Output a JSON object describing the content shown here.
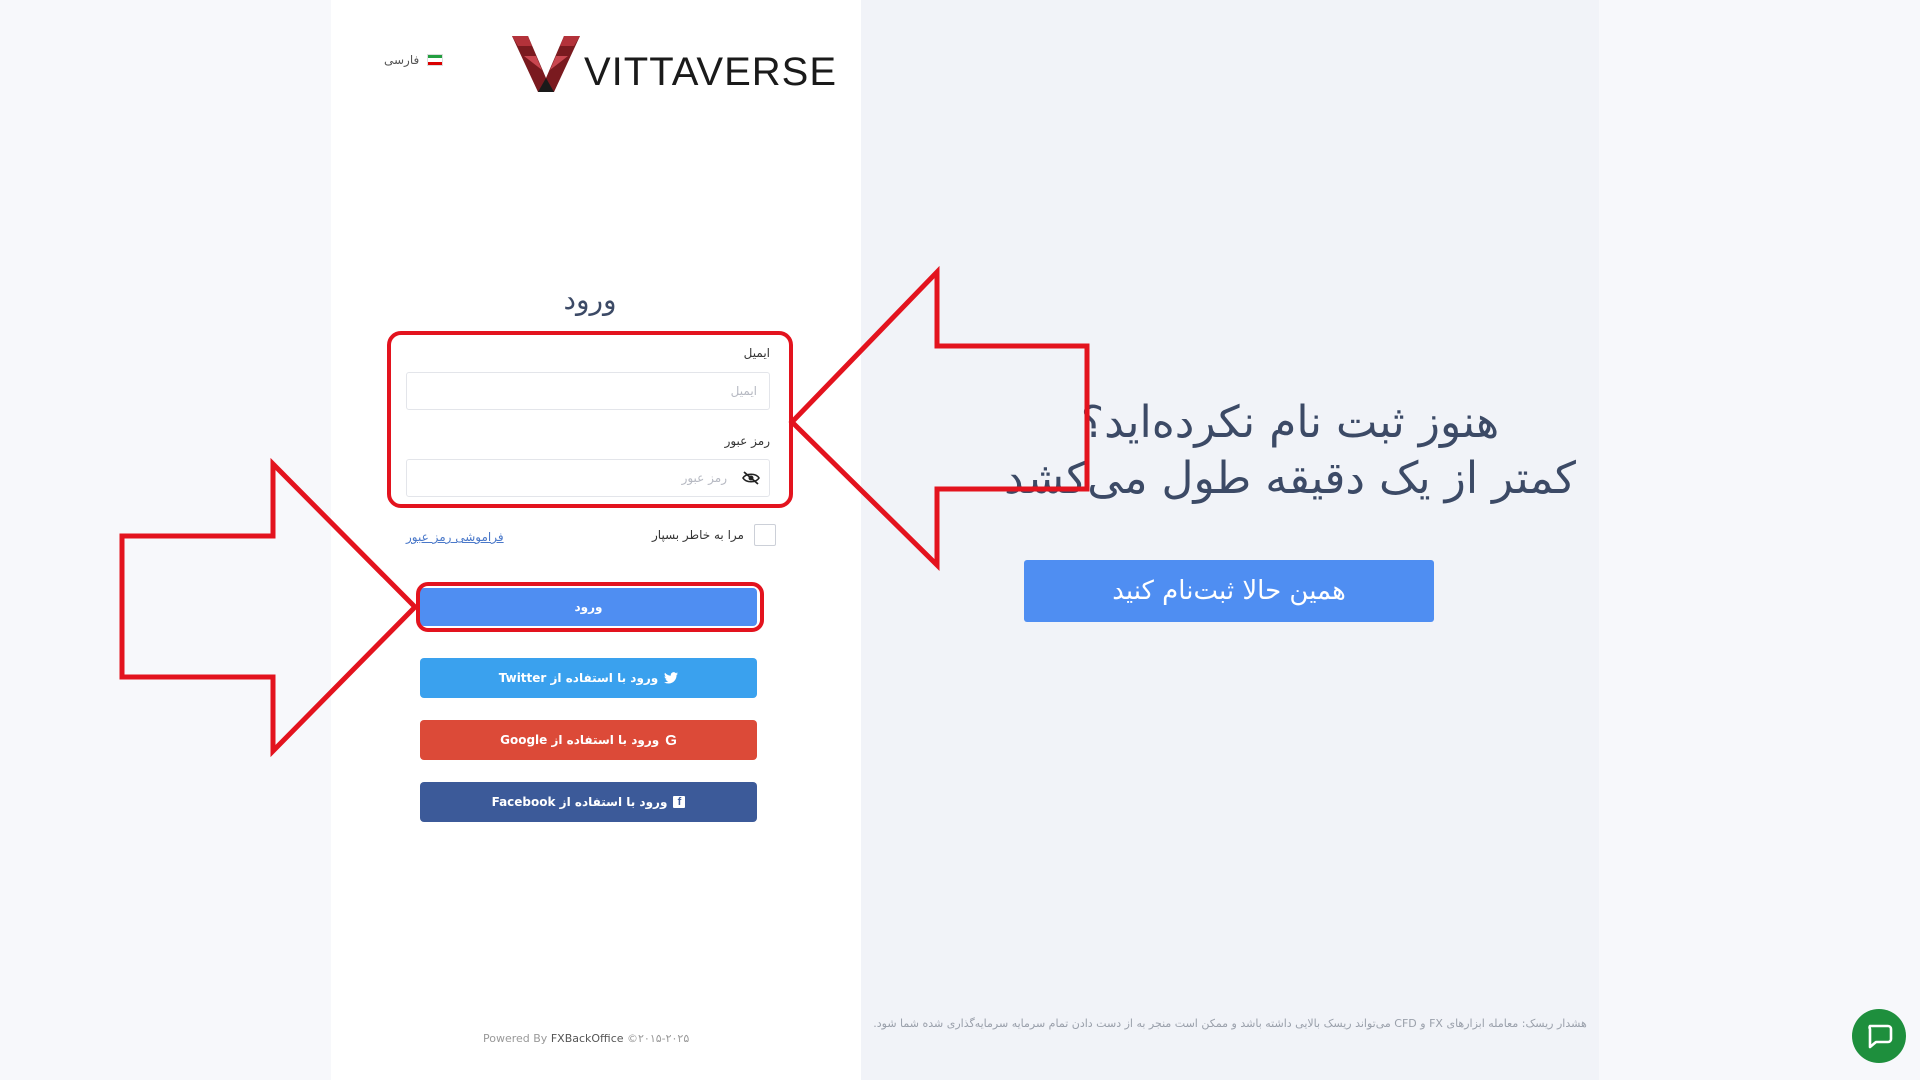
{
  "language": {
    "label": "فارسی"
  },
  "brand": {
    "name": "VITTAVERSE"
  },
  "login": {
    "title": "ورود",
    "email_label": "ایمیل",
    "email_placeholder": "ایمیل",
    "password_label": "رمز عبور",
    "password_placeholder": "رمز عبور",
    "remember_label": "مرا به خاطر بسپار",
    "forgot_label": "فراموشی رمز عبور",
    "submit_label": "ورود",
    "twitter_label": "ورود با استفاده از Twitter",
    "google_label": "ورود با استفاده از Google",
    "facebook_label": "ورود با استفاده از Facebook"
  },
  "footer": {
    "powered_by": "Powered By",
    "vendor": "FXBackOffice",
    "copyright": "©۲۰۱۵-۲۰۲۵"
  },
  "promo": {
    "line1": "هنوز ثبت نام نکرده‌اید؟",
    "line2": "کمتر از یک دقیقه طول می‌کشد",
    "register_label": "همین حالا ثبت‌نام کنید"
  },
  "risk_warning": "هشدار ریسک: معامله ابزارهای FX و CFD می‌تواند ریسک بالایی داشته باشد و ممکن است منجر به از دست دادن تمام سرمایه سرمایه‌گذاری شده شما شود.",
  "colors": {
    "primary": "#4f8ef2",
    "twitter": "#3aa1ee",
    "google": "#dc4a38",
    "facebook": "#3c5a99",
    "annotation": "#e3131e",
    "chat": "#1e8f3d"
  },
  "icons": [
    "flag-iran-icon",
    "eye-slash-icon",
    "twitter-icon",
    "google-icon",
    "facebook-icon",
    "chat-icon"
  ]
}
